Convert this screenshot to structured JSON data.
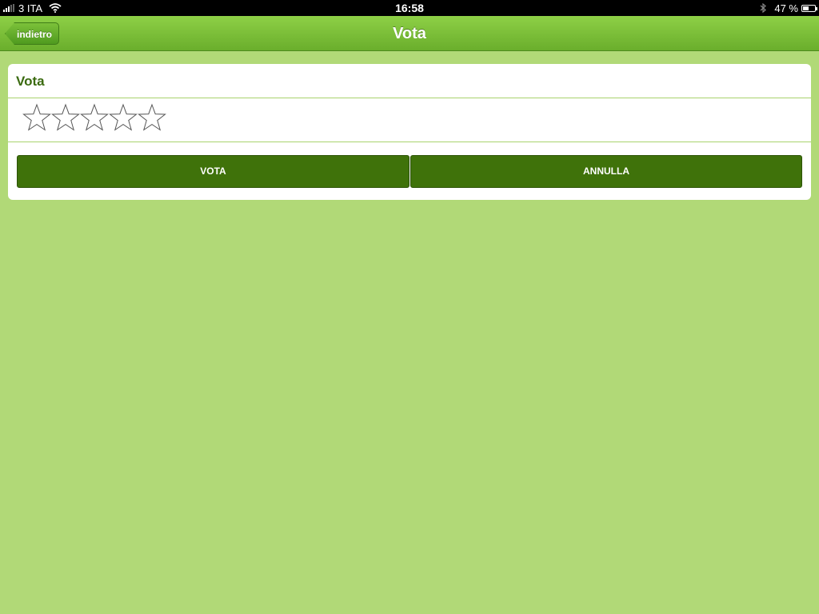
{
  "status_bar": {
    "carrier": "3 ITA",
    "time": "16:58",
    "battery_percent": "47 %",
    "battery_level": 0.47,
    "icons": [
      "signal-icon",
      "wifi-icon",
      "bluetooth-icon",
      "battery-icon"
    ]
  },
  "navbar": {
    "back_label": "indietro",
    "title": "Vota"
  },
  "card": {
    "title": "Vota",
    "rating": 0,
    "max_rating": 5,
    "vote_button": "VOTA",
    "cancel_button": "ANNULLA"
  },
  "colors": {
    "background": "#b1d977",
    "navbar": "#7cc13a",
    "button": "#3f720a",
    "title_text": "#3a6a0f"
  }
}
